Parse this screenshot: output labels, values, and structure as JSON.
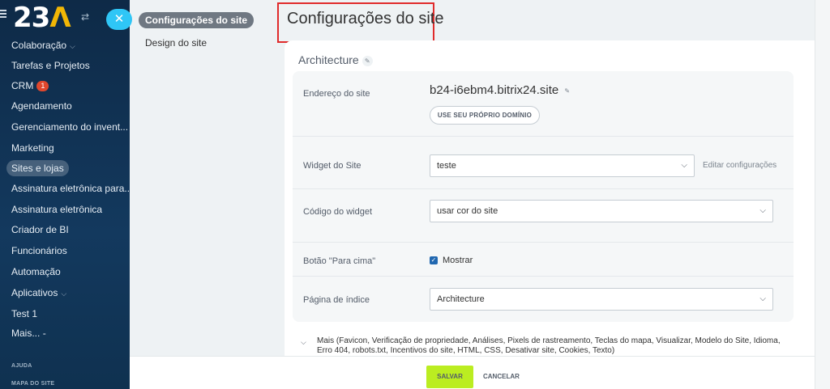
{
  "sidebar": {
    "logo_main": "23",
    "logo_accent": "Λ",
    "close_glyph": "✕",
    "items": [
      {
        "label": "Colaboração",
        "chevron": true
      },
      {
        "label": "Tarefas e Projetos"
      },
      {
        "label": "CRM",
        "badge": "1"
      },
      {
        "label": "Agendamento"
      },
      {
        "label": "Gerenciamento do invent..."
      },
      {
        "label": "Marketing"
      },
      {
        "label": "Sites e lojas",
        "active": true
      },
      {
        "label": "Assinatura eletrônica para..."
      },
      {
        "label": "Assinatura eletrônica"
      },
      {
        "label": "Criador de BI"
      },
      {
        "label": "Funcionários"
      },
      {
        "label": "Automação"
      },
      {
        "label": "Aplicativos",
        "chevron": true
      },
      {
        "label": "Test 1"
      },
      {
        "label": "Mais...",
        "dash": "-"
      }
    ],
    "section_help": "AJUDA",
    "section_sitemap": "MAPA DO SITE"
  },
  "nav": {
    "active": "Configurações do site",
    "link": "Design do site"
  },
  "main": {
    "title": "Configurações do site",
    "card_title": "Architecture",
    "address_label": "Endereço do site",
    "domain": "b24-i6ebm4.bitrix24.site",
    "domain_button": "USE SEU PRÓPRIO DOMÍNIO",
    "widget_label": "Widget do Site",
    "widget_value": "teste",
    "widget_edit": "Editar configurações",
    "code_label": "Código do widget",
    "code_value": "usar cor do site",
    "topbtn_label": "Botão \"Para cima\"",
    "topbtn_check": "Mostrar",
    "index_label": "Página de índice",
    "index_value": "Architecture",
    "more_text": "Mais (Favicon, Verificação de propriedade, Análises, Pixels de rastreamento, Teclas do mapa, Visualizar, Modelo do Site, Idioma, Erro 404, robots.txt, Incentivos do site, HTML, CSS, Desativar site, Cookies, Texto)"
  },
  "footer": {
    "save": "SALVAR",
    "cancel": "CANCELAR"
  },
  "colors": {
    "accent_blue": "#2fc6f6",
    "save_green": "#bbed21",
    "title_box_red": "#e02b2b",
    "badge_red": "#e0472d"
  }
}
